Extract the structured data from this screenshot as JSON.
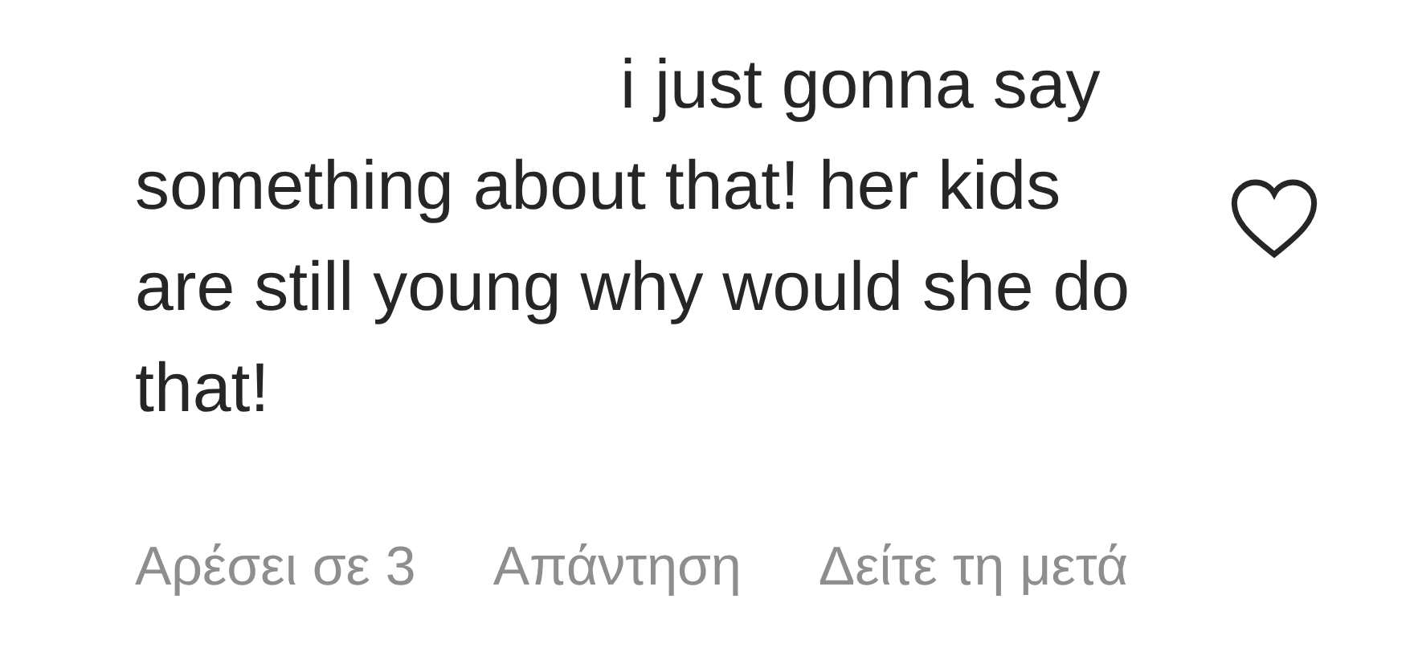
{
  "comment": {
    "text": "i just gonna say something about that! her kids are still young why would she do that!",
    "liked": false
  },
  "actions": [
    {
      "label": "Αρέσει σε 3"
    },
    {
      "label": "Απάντηση"
    },
    {
      "label": "Δείτε τη μετά"
    }
  ]
}
